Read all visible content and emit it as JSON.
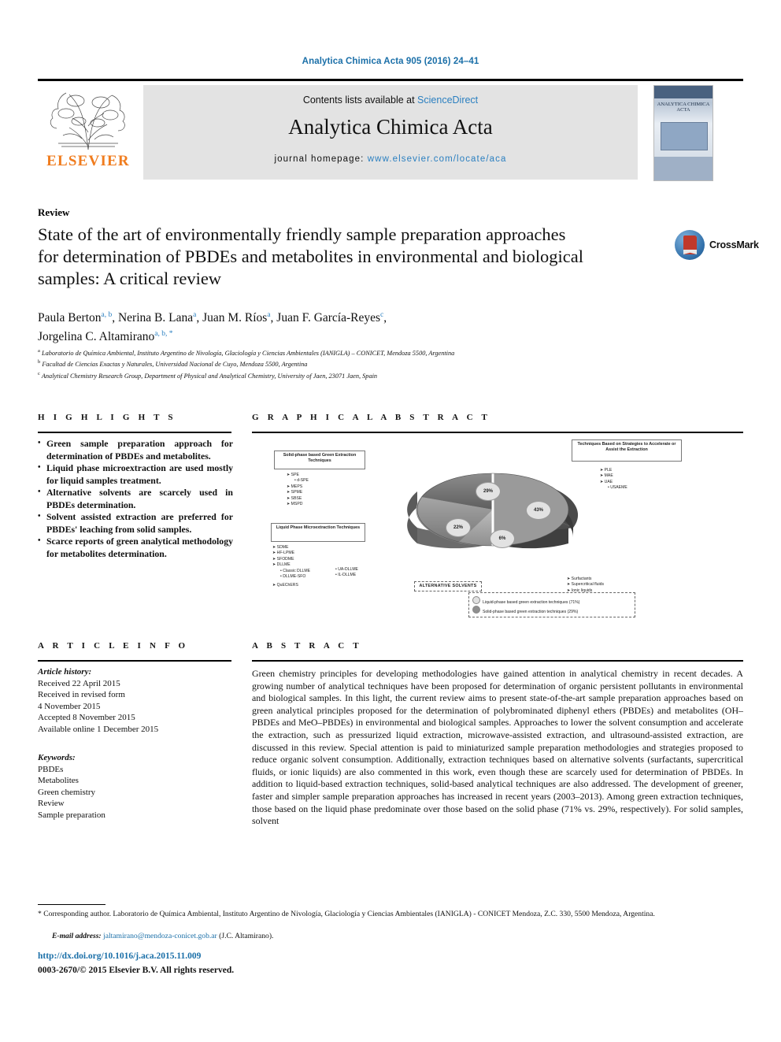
{
  "running_head": "Analytica Chimica Acta 905 (2016) 24–41",
  "masthead": {
    "contents_prefix": "Contents lists available at ",
    "sciencedirect": "ScienceDirect",
    "journal_title": "Analytica Chimica Acta",
    "homepage_label": "journal homepage: ",
    "homepage_url": "www.elsevier.com/locate/aca",
    "publisher": "ELSEVIER",
    "cover_title": "ANALYTICA CHIMICA ACTA"
  },
  "article": {
    "type": "Review",
    "title": "State of the art of environmentally friendly sample preparation approaches for determination of PBDEs and metabolites in environmental and biological samples: A critical review",
    "crossmark_label": "CrossMark",
    "authors_line1": "Paula Berton",
    "authors": [
      {
        "name": "Paula Berton",
        "sup": "a, b"
      },
      {
        "name": "Nerina B. Lana",
        "sup": "a"
      },
      {
        "name": "Juan M. Ríos",
        "sup": "a"
      },
      {
        "name": "Juan F. García-Reyes",
        "sup": "c"
      },
      {
        "name": "Jorgelina C. Altamirano",
        "sup": "a, b, *"
      }
    ],
    "affiliations": [
      {
        "mark": "a",
        "text": "Laboratorio de Química Ambiental, Instituto Argentino de Nivología, Glaciología y Ciencias Ambientales (IANIGLA) – CONICET, Mendoza 5500, Argentina"
      },
      {
        "mark": "b",
        "text": "Facultad de Ciencias Exactas y Naturales, Universidad Nacional de Cuyo, Mendoza 5500, Argentina"
      },
      {
        "mark": "c",
        "text": "Analytical Chemistry Research Group, Department of Physical and Analytical Chemistry, University of Jaen, 23071 Jaen, Spain"
      }
    ]
  },
  "highlights": {
    "heading": "H I G H L I G H T S",
    "items": [
      "Green sample preparation approach for determination of PBDEs and metabolites.",
      "Liquid phase microextraction are used mostly for liquid samples treatment.",
      "Alternative solvents are scarcely used in PBDEs determination.",
      "Solvent assisted extraction are preferred for PBDEs' leaching from solid samples.",
      "Scarce reports of green analytical methodology for metabolites determination."
    ]
  },
  "graphical_abstract": {
    "heading": "G R A P H I C A L   A B S T R A C T"
  },
  "article_info": {
    "heading": "A R T I C L E   I N F O",
    "history_label": "Article history:",
    "history": [
      "Received 22 April 2015",
      "Received in revised form",
      "4 November 2015",
      "Accepted 8 November 2015",
      "Available online 1 December 2015"
    ],
    "keywords_label": "Keywords:",
    "keywords": [
      "PBDEs",
      "Metabolites",
      "Green chemistry",
      "Review",
      "Sample preparation"
    ]
  },
  "abstract": {
    "heading": "A B S T R A C T",
    "text": "Green chemistry principles for developing methodologies have gained attention in analytical chemistry in recent decades. A growing number of analytical techniques have been proposed for determination of organic persistent pollutants in environmental and biological samples. In this light, the current review aims to present state-of-the-art sample preparation approaches based on green analytical principles proposed for the determination of polybrominated diphenyl ethers (PBDEs) and metabolites (OH–PBDEs and MeO–PBDEs) in environmental and biological samples. Approaches to lower the solvent consumption and accelerate the extraction, such as pressurized liquid extraction, microwave-assisted extraction, and ultrasound-assisted extraction, are discussed in this review. Special attention is paid to miniaturized sample preparation methodologies and strategies proposed to reduce organic solvent consumption. Additionally, extraction techniques based on alternative solvents (surfactants, supercritical fluids, or ionic liquids) are also commented in this work, even though these are scarcely used for determination of PBDEs. In addition to liquid-based extraction techniques, solid-based analytical techniques are also addressed. The development of greener, faster and simpler sample preparation approaches has increased in recent years (2003–2013). Among green extraction techniques, those based on the liquid phase predominate over those based on the solid phase (71% vs. 29%, respectively). For solid samples, solvent"
  },
  "footer": {
    "corresponding_mark": "*",
    "corresponding": "Corresponding author. Laboratorio de Química Ambiental, Instituto Argentino de Nivología, Glaciología y Ciencias Ambientales (IANIGLA) - CONICET Mendoza, Z.C. 330, 5500 Mendoza, Argentina.",
    "email_label": "E-mail address:",
    "email": "jaltamirano@mendoza-conicet.gob.ar",
    "email_owner": "(J.C. Altamirano).",
    "doi": "http://dx.doi.org/10.1016/j.aca.2015.11.009",
    "issn": "0003-2670/© 2015 Elsevier B.V. All rights reserved."
  },
  "chart_data": {
    "type": "pie",
    "title": "Green extraction techniques for PBDEs determination",
    "categories": [
      "Techniques based on strategies to accelerate or assist the extraction",
      "Liquid phase microextraction techniques",
      "Alternative solvents",
      "Solid-phase based green extraction techniques"
    ],
    "values": [
      43,
      22,
      6,
      29
    ],
    "labels": [
      "43%",
      "22%",
      "6%",
      "29%"
    ],
    "legend_position": "bottom-right",
    "legend": [
      "Liquid-phase based green extraction techniques (71%)",
      "Solid-phase based green extraction techniques (29%)"
    ],
    "callouts": [
      {
        "title": "Solid-phase based Green Extraction Techniques",
        "items": [
          "➤ SPE",
          "• d-SPE",
          "➤ MEPS",
          "➤ SPME",
          "➤ SBSE",
          "➤ MSPD"
        ]
      },
      {
        "title": "Techniques Based on Strategies to Accelerate or Assist the Extraction",
        "items": [
          "➤ PLE",
          "➤ MAE",
          "➤ UAE",
          "• USAEME"
        ]
      },
      {
        "title": "Liquid Phase Microextraction Techniques",
        "items": [
          "➤ SDME",
          "➤ HF-LPME",
          "➤ SFODME",
          "➤ DLLME",
          "• Classic DLLME",
          "• DLLME-SFO",
          "• UA-DLLME",
          "• IL-DLLME",
          "➤ QuEChERS"
        ]
      },
      {
        "title": "ALTERNATIVE SOLVENTS",
        "items": [
          "➤ Surfactants",
          "➤ Supercritical fluids",
          "➤ Ionic liquids"
        ]
      }
    ]
  }
}
